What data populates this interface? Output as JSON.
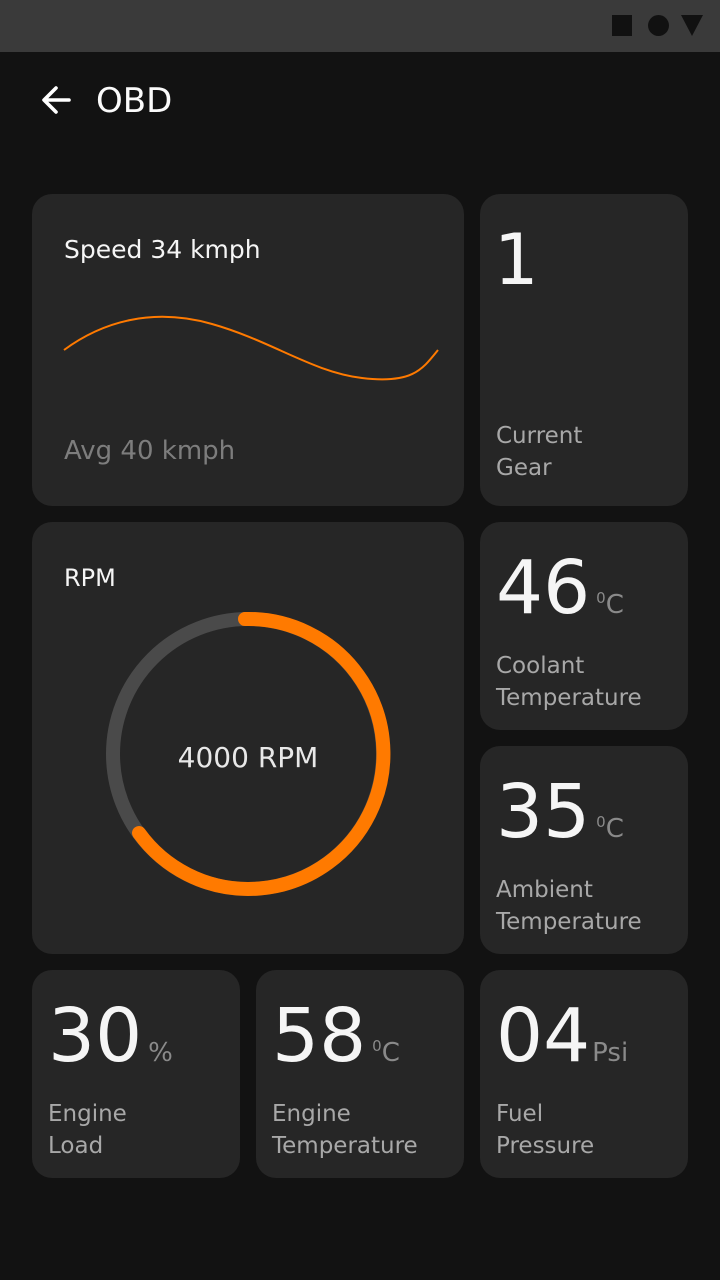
{
  "app": {
    "title": "OBD"
  },
  "speed": {
    "title": "Speed 34 kmph",
    "average": "Avg 40 kmph",
    "accent": "#ff7a00"
  },
  "gear": {
    "value": "1",
    "label_line1": "Current",
    "label_line2": "Gear"
  },
  "rpm": {
    "title": "RPM",
    "value": "4000 RPM",
    "accent": "#ff7a00",
    "track": "#4a4a4a"
  },
  "coolant": {
    "value": "46",
    "unit_super": "0",
    "unit": "C",
    "label_line1": "Coolant",
    "label_line2": "Temperature"
  },
  "ambient": {
    "value": "35",
    "unit_super": "0",
    "unit": "C",
    "label_line1": "Ambient",
    "label_line2": "Temperature"
  },
  "engine_load": {
    "value": "30",
    "unit": "%",
    "label_line1": "Engine",
    "label_line2": "Load"
  },
  "engine_temp": {
    "value": "58",
    "unit_super": "0",
    "unit": "C",
    "label_line1": "Engine",
    "label_line2": "Temperature"
  },
  "fuel_pressure": {
    "value": "04",
    "unit": "Psi",
    "label_line1": "Fuel",
    "label_line2": "Pressure"
  }
}
